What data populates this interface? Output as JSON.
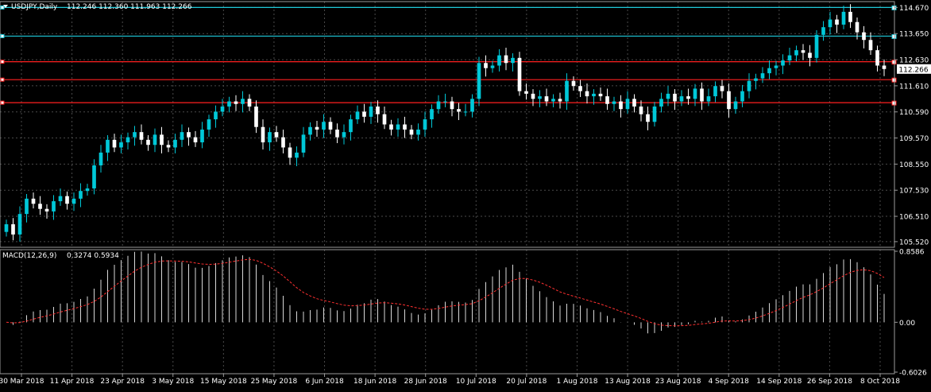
{
  "header": {
    "symbol_label": "USDJPY,Daily",
    "ohlc": "112.246 112.360 111.963 112.266"
  },
  "colors": {
    "background": "#000000",
    "grid": "#4a4a4a",
    "bull": "#00c8d8",
    "bear": "#ffffff",
    "cyan_line": "#1ec8d8",
    "red_line": "#ff2020",
    "macd_hist": "#d8d8d8",
    "macd_signal": "#ff3030",
    "axis_text": "#ffffff",
    "price_tag_bg": "#ffffff",
    "price_tag_text": "#000000"
  },
  "chart_data": [
    {
      "type": "candlestick",
      "symbol": "USDJPY",
      "timeframe": "Daily",
      "last_price": 112.266,
      "ylim": [
        105.3,
        114.9
      ],
      "yticks": [
        "114.670",
        "113.650",
        "112.630",
        "111.610",
        "110.590",
        "109.570",
        "108.550",
        "107.530",
        "106.510",
        "105.520"
      ],
      "ytick_values": [
        114.67,
        113.65,
        112.63,
        111.61,
        110.59,
        109.57,
        108.55,
        107.53,
        106.51,
        105.52
      ],
      "horizontal_levels": [
        {
          "value": 114.67,
          "color": "cyan"
        },
        {
          "value": 113.55,
          "color": "cyan"
        },
        {
          "value": 112.55,
          "color": "red"
        },
        {
          "value": 111.85,
          "color": "red"
        },
        {
          "value": 110.95,
          "color": "red"
        }
      ],
      "x_labels": [
        "30 Mar 2018",
        "11 Apr 2018",
        "23 Apr 2018",
        "3 May 2018",
        "15 May 2018",
        "25 May 2018",
        "6 Jun 2018",
        "18 Jun 2018",
        "28 Jun 2018",
        "10 Jul 2018",
        "20 Jul 2018",
        "1 Aug 2018",
        "13 Aug 2018",
        "23 Aug 2018",
        "4 Sep 2018",
        "14 Sep 2018",
        "26 Sep 2018",
        "8 Oct 2018"
      ],
      "candle_close_approx": [
        106.2,
        105.8,
        106.6,
        107.2,
        107.0,
        106.8,
        106.7,
        107.1,
        107.3,
        107.0,
        107.2,
        107.5,
        107.6,
        108.5,
        109.0,
        109.5,
        109.2,
        109.4,
        109.6,
        109.8,
        109.5,
        109.3,
        109.7,
        109.3,
        109.2,
        109.5,
        109.8,
        109.6,
        109.4,
        109.9,
        110.3,
        110.6,
        110.8,
        111.0,
        110.9,
        111.1,
        110.8,
        110.0,
        109.4,
        109.8,
        109.6,
        109.2,
        108.8,
        109.0,
        109.7,
        110.0,
        109.9,
        110.2,
        109.9,
        109.6,
        109.8,
        110.3,
        110.6,
        110.4,
        110.8,
        110.5,
        110.1,
        109.9,
        110.1,
        109.9,
        109.7,
        109.9,
        110.3,
        110.7,
        111.0,
        111.0,
        110.7,
        110.6,
        110.6,
        111.1,
        112.5,
        112.3,
        112.4,
        112.8,
        112.5,
        112.7,
        111.4,
        111.3,
        111.1,
        111.2,
        111.0,
        111.1,
        111.0,
        111.8,
        111.6,
        111.4,
        111.2,
        111.3,
        111.2,
        110.9,
        111.0,
        110.7,
        111.1,
        110.8,
        110.5,
        110.2,
        110.8,
        111.1,
        111.3,
        111.0,
        111.2,
        111.1,
        111.5,
        111.0,
        111.2,
        111.6,
        111.4,
        110.7,
        111.0,
        111.4,
        111.8,
        111.9,
        112.1,
        112.3,
        112.4,
        112.6,
        112.8,
        113.0,
        112.9,
        112.7,
        113.6,
        113.9,
        114.2,
        114.0,
        114.5,
        114.1,
        113.7,
        113.4,
        113.0,
        112.4,
        112.266
      ]
    },
    {
      "type": "macd",
      "label": "MACD(12,26,9)",
      "values_label": "0.3274 0.5934",
      "macd": 0.3274,
      "signal": 0.5934,
      "ylim": [
        -0.6026,
        0.8586
      ],
      "yticks": [
        "0.8586",
        "0.00",
        "-0.6026"
      ],
      "ytick_values": [
        0.8586,
        0.0,
        -0.6026
      ]
    }
  ]
}
